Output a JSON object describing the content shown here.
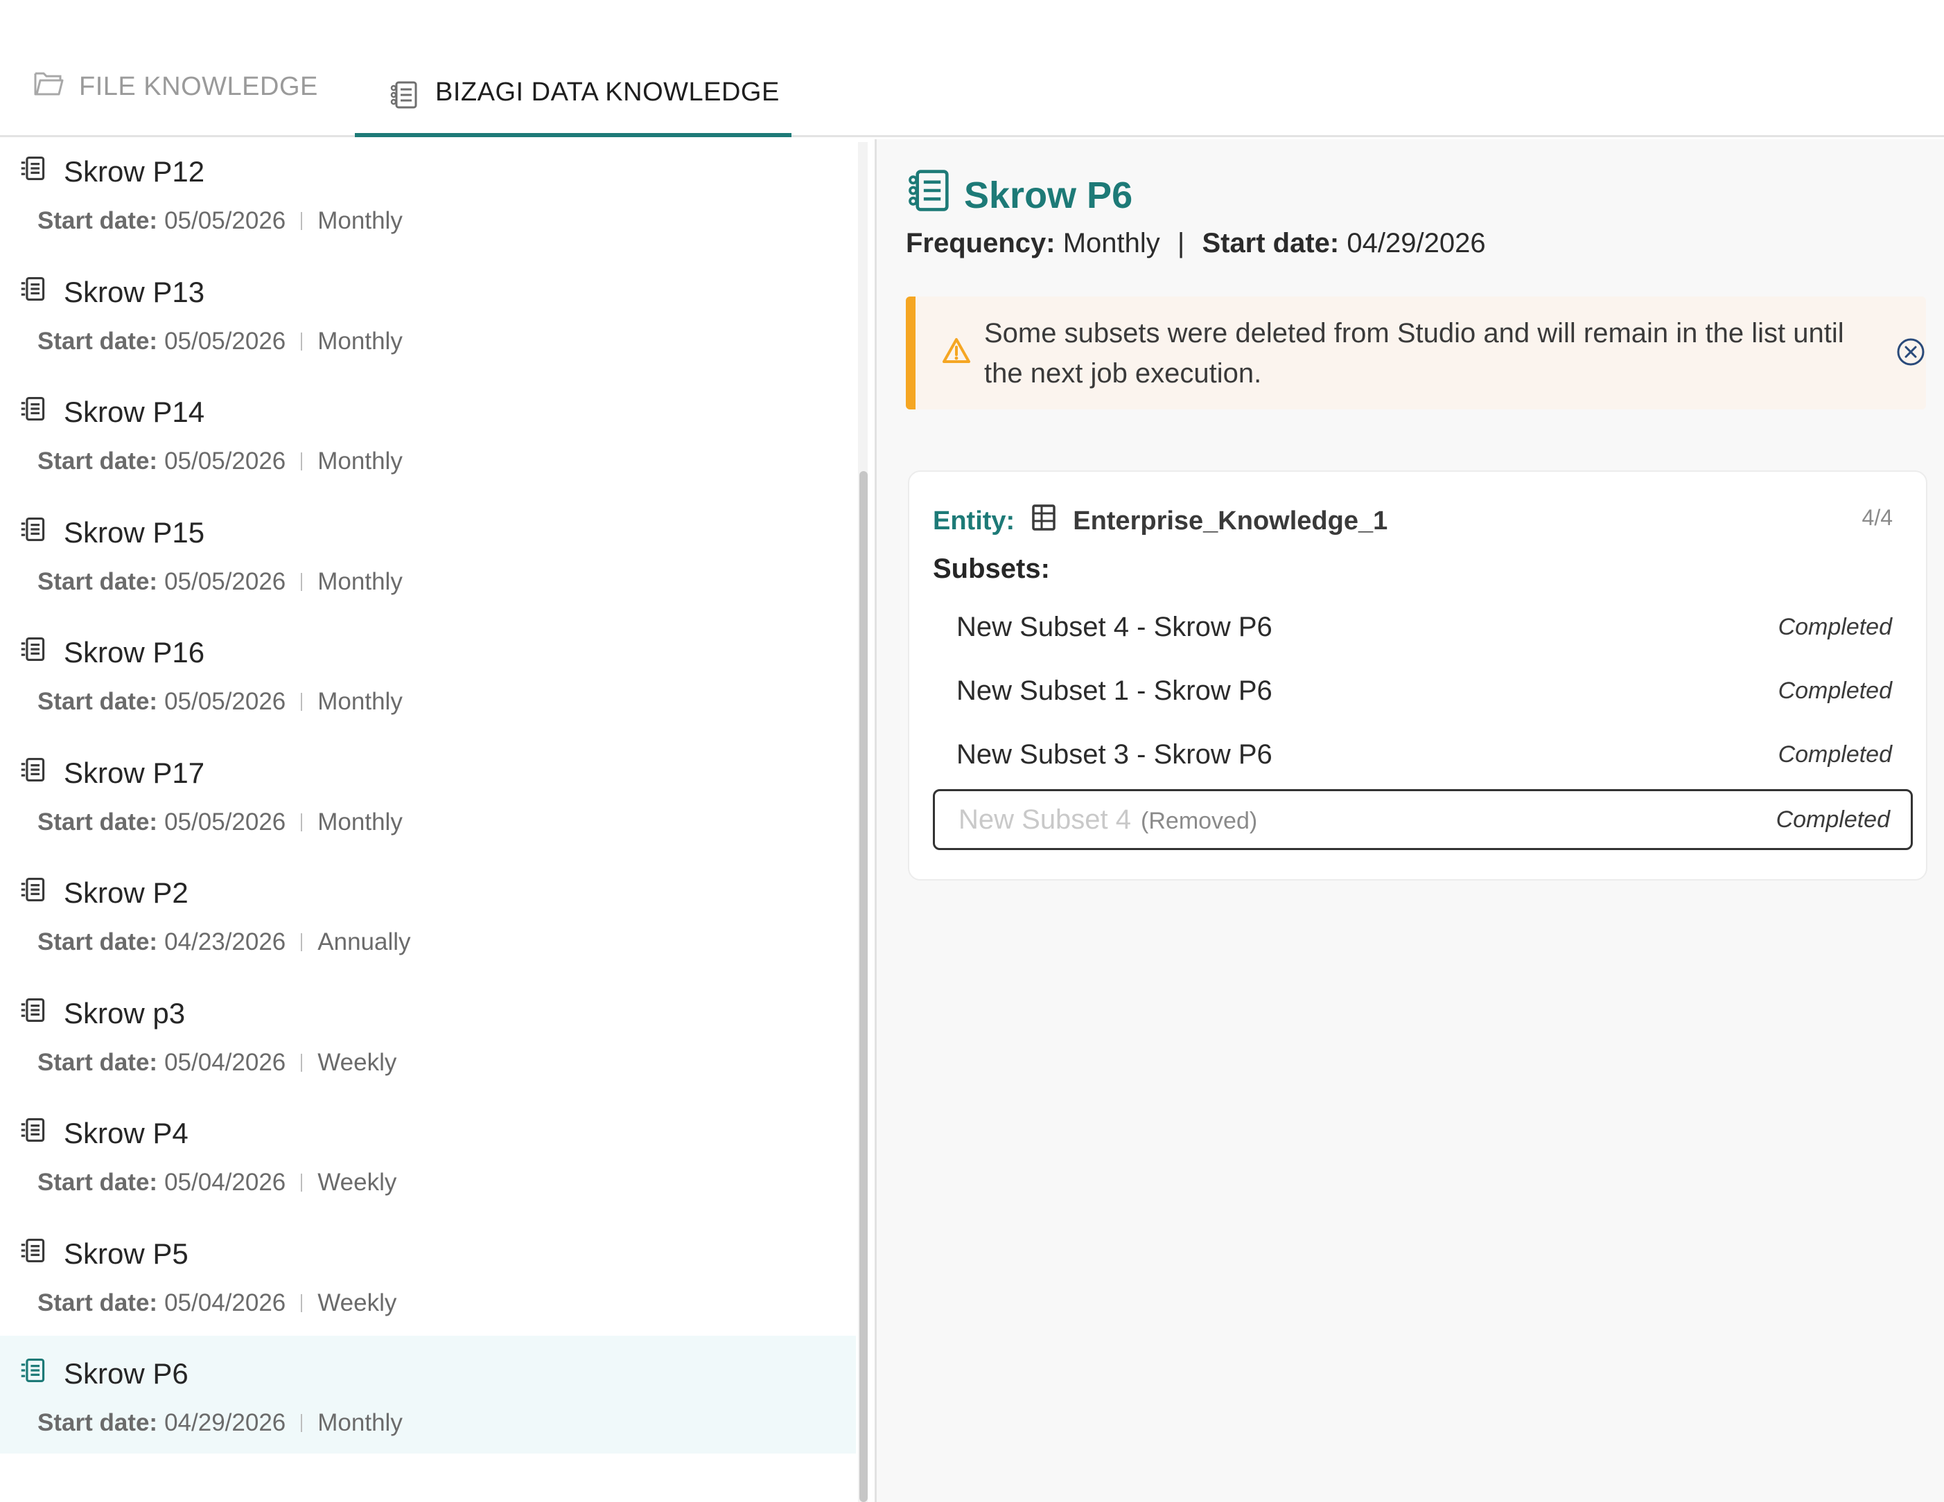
{
  "tabs": [
    {
      "label": "FILE KNOWLEDGE",
      "icon": "folder-open-icon",
      "active": false
    },
    {
      "label": "BIZAGI DATA KNOWLEDGE",
      "icon": "document-list-icon",
      "active": true
    }
  ],
  "list": {
    "start_date_label": "Start date:",
    "items": [
      {
        "name": "Skrow P12",
        "start_date": "05/05/2026",
        "frequency": "Monthly"
      },
      {
        "name": "Skrow P13",
        "start_date": "05/05/2026",
        "frequency": "Monthly"
      },
      {
        "name": "Skrow P14",
        "start_date": "05/05/2026",
        "frequency": "Monthly"
      },
      {
        "name": "Skrow P15",
        "start_date": "05/05/2026",
        "frequency": "Monthly"
      },
      {
        "name": "Skrow P16",
        "start_date": "05/05/2026",
        "frequency": "Monthly"
      },
      {
        "name": "Skrow P17",
        "start_date": "05/05/2026",
        "frequency": "Monthly"
      },
      {
        "name": "Skrow P2",
        "start_date": "04/23/2026",
        "frequency": "Annually"
      },
      {
        "name": "Skrow p3",
        "start_date": "05/04/2026",
        "frequency": "Weekly"
      },
      {
        "name": "Skrow P4",
        "start_date": "05/04/2026",
        "frequency": "Weekly"
      },
      {
        "name": "Skrow P5",
        "start_date": "05/04/2026",
        "frequency": "Weekly"
      },
      {
        "name": "Skrow P6",
        "start_date": "04/29/2026",
        "frequency": "Monthly",
        "selected": true
      }
    ]
  },
  "detail": {
    "title": "Skrow P6",
    "frequency_label": "Frequency:",
    "frequency": "Monthly",
    "separator": "|",
    "start_date_label": "Start date:",
    "start_date": "04/29/2026",
    "warning": {
      "text": "Some subsets were deleted from Studio and will remain in the list until the next job execution."
    },
    "entity_card": {
      "entity_label": "Entity:",
      "entity_name": "Enterprise_Knowledge_1",
      "count": "4/4",
      "subsets_label": "Subsets:",
      "subsets": [
        {
          "name": "New Subset 4 - Skrow P6",
          "status": "Completed"
        },
        {
          "name": "New Subset 1 - Skrow P6",
          "status": "Completed"
        },
        {
          "name": "New Subset 3 - Skrow P6",
          "status": "Completed"
        },
        {
          "name": "New Subset 4",
          "removed_tag": "(Removed)",
          "status": "Completed",
          "removed": true
        }
      ]
    }
  },
  "colors": {
    "accent": "#1d7a77",
    "warning": "#f5a623",
    "selected_bg": "#f0f9fa",
    "warning_bg": "#fbf4ee"
  }
}
